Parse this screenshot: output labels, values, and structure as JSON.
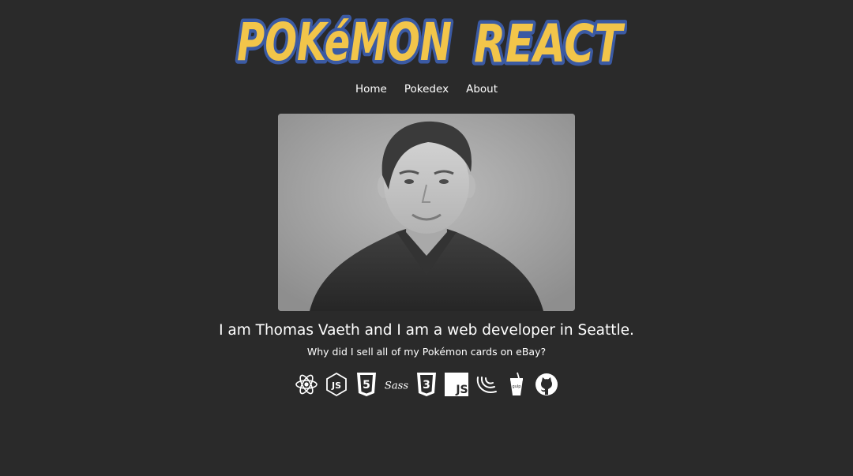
{
  "app": {
    "logo_text": "Pokémon React"
  },
  "nav": {
    "items": [
      {
        "label": "Home"
      },
      {
        "label": "Pokedex"
      },
      {
        "label": "About"
      }
    ]
  },
  "about": {
    "headline": "I am Thomas Vaeth and I am a web developer in Seattle.",
    "subline": "Why did I sell all of my Pokémon cards on eBay?"
  },
  "tech_icons": [
    "react-icon",
    "nodejs-icon",
    "html5-icon",
    "sass-icon",
    "css3-icon",
    "javascript-icon",
    "jquery-icon",
    "gulp-icon",
    "github-icon"
  ],
  "colors": {
    "background": "#2a2a2a",
    "logo_fill": "#f2c54a",
    "logo_outline": "#3b5aa3",
    "text": "#ffffff"
  }
}
